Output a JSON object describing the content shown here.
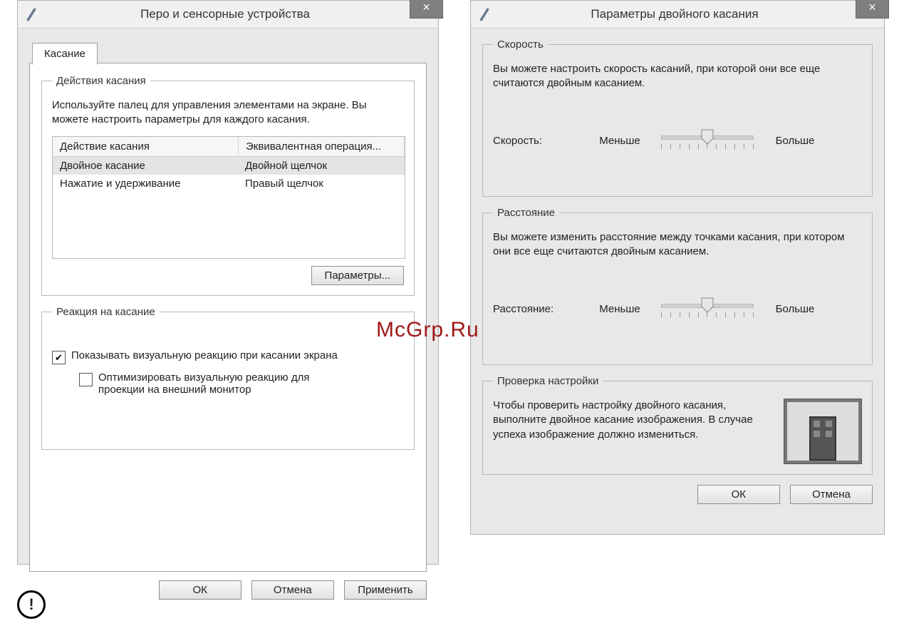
{
  "watermark": "McGrp.Ru",
  "dialog1": {
    "title": "Перо и сенсорные устройства",
    "close_glyph": "×",
    "tab_label": "Касание",
    "group_actions": {
      "legend": "Действия касания",
      "intro": "Используйте палец для управления элементами на экране. Вы можете настроить параметры для каждого касания.",
      "col_action": "Действие касания",
      "col_op": "Эквивалентная операция...",
      "rows": [
        {
          "a": "Двойное касание",
          "b": "Двойной щелчок"
        },
        {
          "a": "Нажатие и удерживание",
          "b": "Правый щелчок"
        }
      ],
      "params_btn": "Параметры..."
    },
    "group_feedback": {
      "legend": "Реакция на касание",
      "chk1": "Показывать визуальную реакцию при касании экрана",
      "chk2": "Оптимизировать визуальную реакцию для проекции на внешний монитор"
    },
    "ok": "ОК",
    "cancel": "Отмена",
    "apply": "Применить"
  },
  "dialog2": {
    "title": "Параметры двойного касания",
    "close_glyph": "×",
    "group_speed": {
      "legend": "Скорость",
      "intro": "Вы можете настроить скорость касаний, при которой они все еще считаются двойным касанием.",
      "label": "Скорость:",
      "min": "Меньше",
      "max": "Больше"
    },
    "group_dist": {
      "legend": "Расстояние",
      "intro": "Вы можете изменить расстояние между точками касания, при котором они все еще считаются двойным касанием.",
      "label": "Расстояние:",
      "min": "Меньше",
      "max": "Больше"
    },
    "group_test": {
      "legend": "Проверка настройки",
      "intro": "Чтобы проверить настройку двойного касания, выполните двойное касание изображения. В случае успеха изображение должно измениться."
    },
    "ok": "ОК",
    "cancel": "Отмена"
  }
}
